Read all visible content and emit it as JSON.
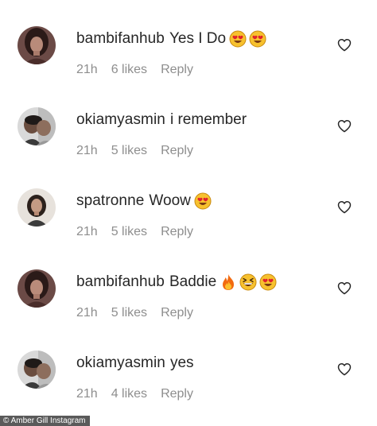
{
  "comments": [
    {
      "username": "bambifanhub",
      "text": "Yes I Do",
      "emojis": [
        "heart-eyes-emoji",
        "heart-eyes-emoji"
      ],
      "time": "21h",
      "likes": "6 likes",
      "reply": "Reply",
      "avatar": "woman-dark-hair"
    },
    {
      "username": "okiamyasmin",
      "text": "i remember",
      "emojis": [],
      "time": "21h",
      "likes": "5 likes",
      "reply": "Reply",
      "avatar": "couple-photo"
    },
    {
      "username": "spatronne",
      "text": "Woow",
      "emojis": [
        "heart-eyes-emoji"
      ],
      "time": "21h",
      "likes": "5 likes",
      "reply": "Reply",
      "avatar": "woman-light-background"
    },
    {
      "username": "bambifanhub",
      "text": "Baddie",
      "emojis": [
        "fire-emoji",
        "grinning-squint-emoji",
        "heart-eyes-emoji"
      ],
      "time": "21h",
      "likes": "5 likes",
      "reply": "Reply",
      "avatar": "woman-dark-hair"
    },
    {
      "username": "okiamyasmin",
      "text": "yes",
      "emojis": [],
      "time": "21h",
      "likes": "4 likes",
      "reply": "Reply",
      "avatar": "couple-photo"
    }
  ],
  "credit": "© Amber Gill Instagram",
  "colors": {
    "text": "#262626",
    "meta": "#8e8e8e",
    "heart_outline": "#262626"
  }
}
